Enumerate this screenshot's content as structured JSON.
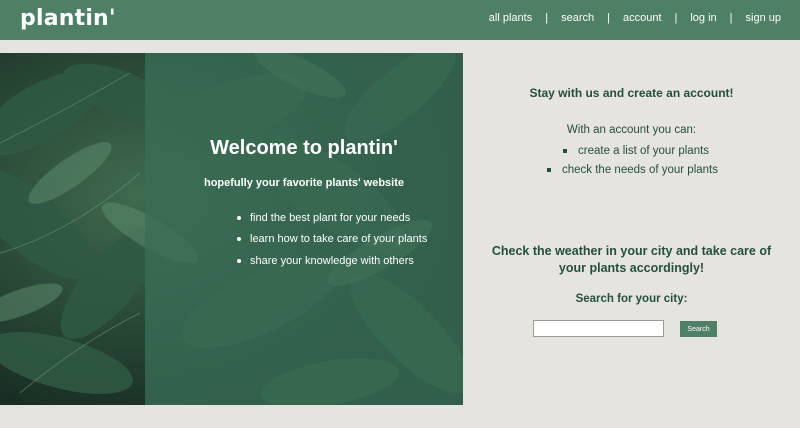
{
  "header": {
    "logo": "plantin'",
    "nav": [
      {
        "label": "all plants"
      },
      {
        "label": "search"
      },
      {
        "label": "account"
      },
      {
        "label": "log in"
      },
      {
        "label": "sign up"
      }
    ],
    "separator": "|"
  },
  "hero": {
    "title": "Welcome to plantin'",
    "subtitle": "hopefully your favorite plants' website",
    "features": [
      "find the best plant for your needs",
      "learn how to take care of your plants",
      "share your knowledge with others"
    ]
  },
  "account_panel": {
    "title": "Stay with us and create an account!",
    "intro": "With an account you can:",
    "benefits": [
      "create a list of your plants",
      "check the needs of your plants"
    ]
  },
  "weather_panel": {
    "title": "Check the weather in your city and take care of your plants accordingly!",
    "search_label": "Search for your city:",
    "city_input_value": "",
    "search_button": "Search"
  },
  "colors": {
    "primary": "#4e8066",
    "text_dark_green": "#23503a",
    "background": "#e6e4df"
  }
}
